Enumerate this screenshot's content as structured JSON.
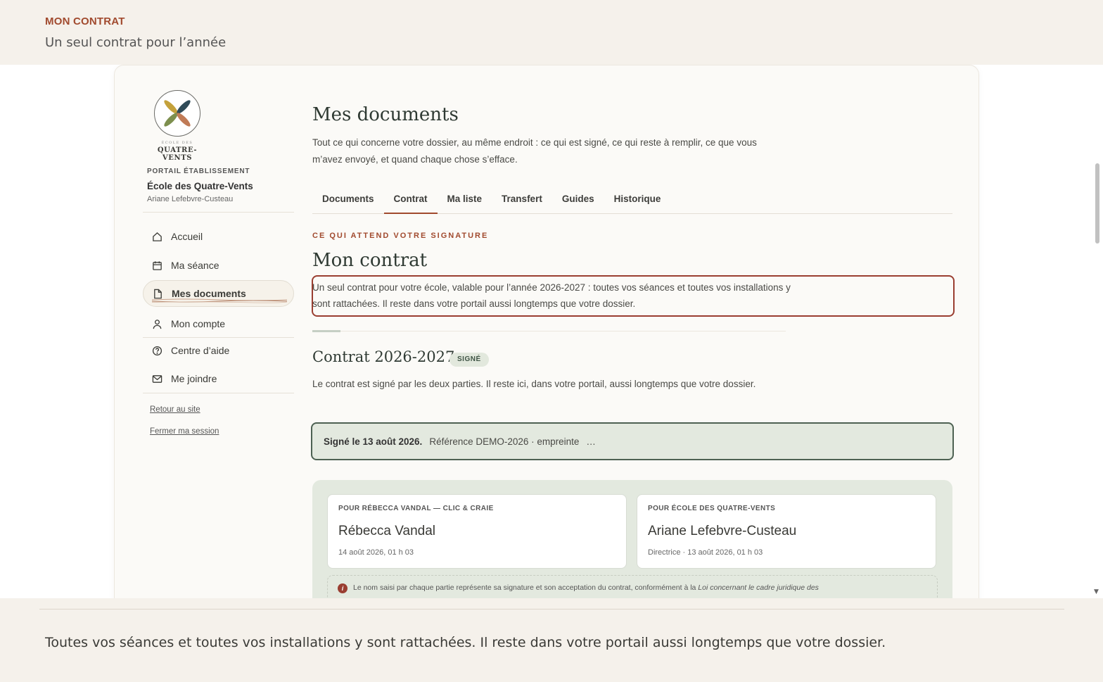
{
  "banner": {
    "kicker": "MON CONTRAT",
    "subtitle": "Un seul contrat pour l’année"
  },
  "sidebar": {
    "logo_small": "ÉCOLE DES",
    "logo_name": "QUATRE-VENTS",
    "portal_label": "PORTAIL ÉTABLISSEMENT",
    "school_name": "École des Quatre-Vents",
    "user_name": "Ariane Lefebvre-Custeau",
    "items": [
      {
        "label": "Accueil",
        "icon": "home-icon"
      },
      {
        "label": "Ma séance",
        "icon": "calendar-icon"
      },
      {
        "label": "Mes documents",
        "icon": "document-icon",
        "active": true
      },
      {
        "label": "Mon compte",
        "icon": "user-icon"
      },
      {
        "label": "Centre d’aide",
        "icon": "help-icon"
      },
      {
        "label": "Me joindre",
        "icon": "mail-icon"
      }
    ],
    "links": [
      "Retour au site",
      "Fermer ma session"
    ]
  },
  "main": {
    "title": "Mes documents",
    "description": "Tout ce qui concerne votre dossier, au même endroit : ce qui est signé, ce qui reste à remplir, ce que vous m’avez envoyé, et quand chaque chose s’efface.",
    "tabs": [
      {
        "label": "Documents"
      },
      {
        "label": "Contrat",
        "active": true
      },
      {
        "label": "Ma liste"
      },
      {
        "label": "Transfert"
      },
      {
        "label": "Guides"
      },
      {
        "label": "Historique"
      }
    ],
    "kicker": "CE QUI ATTEND VOTRE SIGNATURE",
    "section_title": "Mon contrat",
    "intro": "Un seul contrat pour votre école, valable pour l’année 2026-2027 : toutes vos séances et toutes vos installations y sont rattachées. Il reste dans votre portail aussi longtemps que votre dossier.",
    "contract": {
      "title": "Contrat 2026-2027",
      "badge": "SIGNÉ",
      "description": "Le contrat est signé par les deux parties. Il reste ici, dans votre portail, aussi longtemps que votre dossier.",
      "signed_label": "Signé le 13 août 2026.",
      "reference": "Référence DEMO-2026 · empreinte",
      "reference_more": "…",
      "signatures": [
        {
          "role": "POUR RÉBECCA VANDAL — CLIC & CRAIE",
          "name": "Rébecca Vandal",
          "meta": "14 août 2026, 01 h 03"
        },
        {
          "role": "POUR ÉCOLE DES QUATRE-VENTS",
          "name": "Ariane Lefebvre-Custeau",
          "meta": "Directrice · 13 août 2026, 01 h 03"
        }
      ],
      "legal_text": "Le nom saisi par chaque partie représente sa signature et son acceptation du contrat, conformément à la",
      "legal_law": "Loi concernant le cadre juridique des"
    }
  },
  "footer": {
    "caption": "Toutes vos séances et toutes vos installations y sont rattachées. Il reste dans votre portail aussi longtemps que votre dossier."
  },
  "colors": {
    "accent": "#a14a2e",
    "signed_green": "#4d6152",
    "panel_green": "#e3e9df",
    "highlight_red": "#9a3e31"
  }
}
